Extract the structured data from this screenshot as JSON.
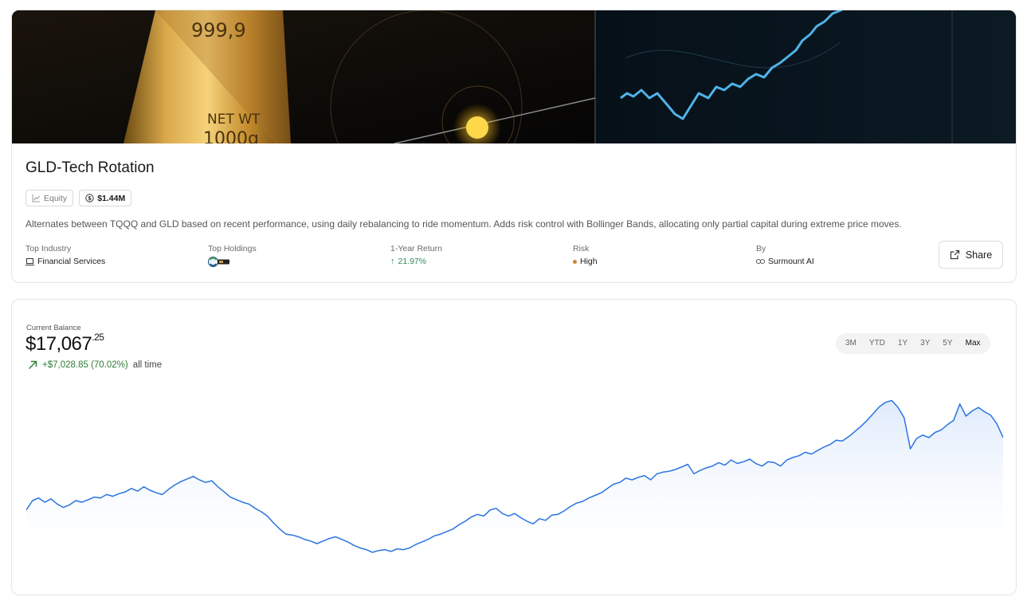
{
  "strategy": {
    "title": "GLD-Tech Rotation",
    "tags": [
      {
        "icon": "line-chart-icon",
        "label": "Equity"
      },
      {
        "icon": "dollar-circle-icon",
        "label": "$1.44M"
      }
    ],
    "description": "Alternates between TQQQ and GLD based on recent performance, using daily rebalancing to ride momentum. Adds risk control with Bollinger Bands, allocating only partial capital during extreme price moves.",
    "hero": {
      "bar_text_1": "999,9",
      "bar_text_2": "NET WT",
      "bar_text_3": "1000g"
    }
  },
  "meta": {
    "industry_label": "Top Industry",
    "industry_value": "Financial Services",
    "holdings_label": "Top Holdings",
    "return_label": "1-Year Return",
    "return_value": "21.97%",
    "risk_label": "Risk",
    "risk_value": "High",
    "by_label": "By",
    "by_value": "Surmount AI",
    "share_label": "Share"
  },
  "balance": {
    "label": "Current Balance",
    "whole": "$17,067",
    "cents": ".25",
    "gain": "+$7,028.85 (70.02%)",
    "gain_period": "all time"
  },
  "ranges": [
    {
      "label": "3M",
      "active": false
    },
    {
      "label": "YTD",
      "active": false
    },
    {
      "label": "1Y",
      "active": false
    },
    {
      "label": "3Y",
      "active": false
    },
    {
      "label": "5Y",
      "active": false
    },
    {
      "label": "Max",
      "active": true
    }
  ],
  "colors": {
    "line": "#2b74e0",
    "gain": "#2e7d32",
    "risk_dot": "#c8892b"
  },
  "chart_data": {
    "type": "area",
    "title": "",
    "xlabel": "",
    "ylabel": "",
    "grid": false,
    "ylim": [
      9000,
      18800
    ],
    "series": [
      {
        "values": [
          12150,
          12700,
          12850,
          12600,
          12800,
          12500,
          12300,
          12450,
          12700,
          12600,
          12750,
          12900,
          12850,
          13050,
          12950,
          13100,
          13200,
          13400,
          13250,
          13500,
          13300,
          13150,
          13050,
          13350,
          13600,
          13800,
          13950,
          14100,
          13900,
          13750,
          13850,
          13500,
          13200,
          12900,
          12750,
          12600,
          12500,
          12250,
          12050,
          11800,
          11400,
          11050,
          10750,
          10700,
          10600,
          10450,
          10350,
          10200,
          10350,
          10500,
          10600,
          10450,
          10300,
          10100,
          9950,
          9850,
          9700,
          9800,
          9850,
          9750,
          9900,
          9850,
          9950,
          10150,
          10300,
          10450,
          10650,
          10750,
          10900,
          11050,
          11300,
          11500,
          11750,
          11900,
          11800,
          12150,
          12250,
          11950,
          11800,
          11950,
          11700,
          11500,
          11350,
          11650,
          11550,
          11850,
          11900,
          12100,
          12350,
          12550,
          12650,
          12850,
          13000,
          13150,
          13400,
          13650,
          13750,
          14000,
          13900,
          14050,
          14150,
          13900,
          14250,
          14350,
          14400,
          14500,
          14650,
          14800,
          14250,
          14450,
          14600,
          14700,
          14900,
          14750,
          15050,
          14850,
          14950,
          15100,
          14850,
          14700,
          14950,
          14900,
          14700,
          15050,
          15200,
          15300,
          15500,
          15400,
          15600,
          15800,
          15950,
          16200,
          16150,
          16400,
          16700,
          17000,
          17350,
          17750,
          18150,
          18400,
          18500,
          18100,
          17500,
          15700,
          16300,
          16500,
          16350,
          16650,
          16800,
          17100,
          17350,
          18300,
          17600,
          17900,
          18100,
          17850,
          17650,
          17150,
          16350
        ]
      }
    ]
  }
}
